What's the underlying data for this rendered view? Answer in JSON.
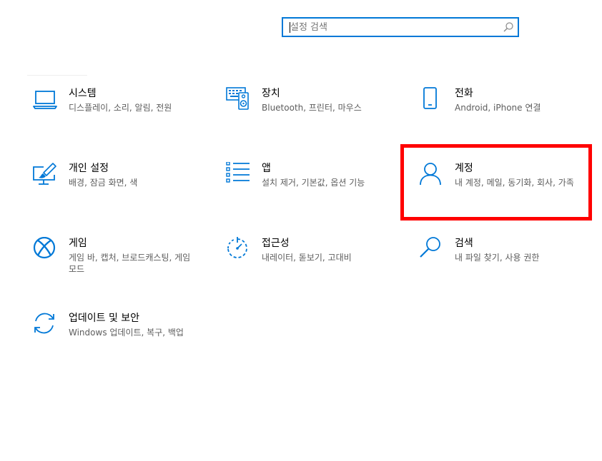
{
  "search": {
    "placeholder": "설정 검색",
    "value": ""
  },
  "accent_color": "#0078d7",
  "highlight_color": "#ff0000",
  "tiles": [
    {
      "title": "시스템",
      "desc": "디스플레이, 소리, 알림, 전원",
      "icon": "laptop-icon"
    },
    {
      "title": "장치",
      "desc": "Bluetooth, 프린터, 마우스",
      "icon": "keyboard-speaker-icon"
    },
    {
      "title": "전화",
      "desc": "Android, iPhone 연결",
      "icon": "phone-icon"
    },
    {
      "title": "개인 설정",
      "desc": "배경, 잠금 화면, 색",
      "icon": "paint-monitor-icon"
    },
    {
      "title": "앱",
      "desc": "설치 제거, 기본값, 옵션 기능",
      "icon": "apps-list-icon"
    },
    {
      "title": "계정",
      "desc": "내 계정, 메일, 동기화, 회사, 가족",
      "icon": "person-icon"
    },
    {
      "title": "게임",
      "desc": "게임 바, 캡처, 브로드캐스팅, 게임 모드",
      "icon": "xbox-icon"
    },
    {
      "title": "접근성",
      "desc": "내레이터, 돋보기, 고대비",
      "icon": "ease-of-access-icon"
    },
    {
      "title": "검색",
      "desc": "내 파일 찾기, 사용 권한",
      "icon": "search-icon"
    },
    {
      "title": "업데이트 및 보안",
      "desc": "Windows 업데이트, 복구, 백업",
      "icon": "sync-icon"
    }
  ]
}
